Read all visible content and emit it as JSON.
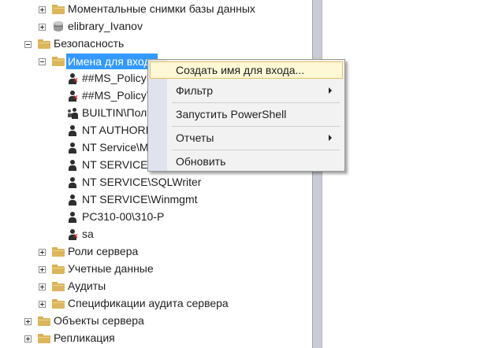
{
  "tree": {
    "nodes": [
      {
        "label": "Моментальные снимки базы данных",
        "icon": "folder-icon",
        "expander": "plus"
      },
      {
        "label": "elibrary_Ivanov",
        "icon": "database-icon",
        "expander": "plus"
      },
      {
        "label": "Безопасность",
        "icon": "folder-icon",
        "expander": "minus"
      },
      {
        "label": "Имена для входа",
        "icon": "folder-icon",
        "expander": "minus",
        "selected": true
      },
      {
        "label": "##MS_PolicyEventProcessingLogin##",
        "icon": "disabled-login-icon"
      },
      {
        "label": "##MS_PolicyTsqlExecutionLogin##",
        "icon": "disabled-login-icon"
      },
      {
        "label": "BUILTIN\\Пользователи",
        "icon": "group-login-icon"
      },
      {
        "label": "NT AUTHORITY\\SYSTEM",
        "icon": "login-icon"
      },
      {
        "label": "NT Service\\MSSQLSERVER",
        "icon": "login-icon"
      },
      {
        "label": "NT SERVICE\\SQLSERVERAGENT",
        "icon": "login-icon"
      },
      {
        "label": "NT SERVICE\\SQLWriter",
        "icon": "login-icon"
      },
      {
        "label": "NT SERVICE\\Winmgmt",
        "icon": "login-icon"
      },
      {
        "label": "PC310-00\\310-P",
        "icon": "login-icon"
      },
      {
        "label": "sa",
        "icon": "disabled-login-icon"
      },
      {
        "label": "Роли сервера",
        "icon": "folder-icon",
        "expander": "plus"
      },
      {
        "label": "Учетные данные",
        "icon": "folder-icon",
        "expander": "plus"
      },
      {
        "label": "Аудиты",
        "icon": "folder-icon",
        "expander": "plus"
      },
      {
        "label": "Спецификации аудита сервера",
        "icon": "folder-icon",
        "expander": "plus"
      },
      {
        "label": "Объекты сервера",
        "icon": "folder-icon",
        "expander": "plus"
      },
      {
        "label": "Репликация",
        "icon": "folder-icon",
        "expander": "plus"
      }
    ]
  },
  "context_menu": {
    "items": [
      {
        "label": "Создать имя для входа...",
        "highlighted": true
      },
      {
        "label": "Фильтр",
        "submenu": true
      },
      {
        "label": "Запустить PowerShell"
      },
      {
        "label": "Отчеты",
        "submenu": true
      },
      {
        "label": "Обновить"
      }
    ]
  },
  "colors": {
    "selection": "#3399ff",
    "menu_highlight": "#fff8d6",
    "folder": "#dcb65a"
  }
}
